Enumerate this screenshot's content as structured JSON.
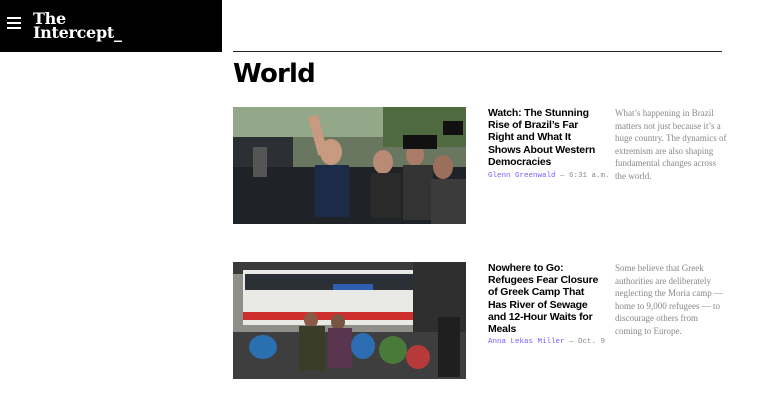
{
  "header": {
    "logo_line1": "The",
    "logo_line2": "Intercept_",
    "menu_icon": "hamburger-menu-icon"
  },
  "section": {
    "title": "World"
  },
  "articles": [
    {
      "headline": "Watch: The Stunning Rise of Brazil’s Far Right and What It Shows About Western Democracies",
      "author": "Glenn Greenwald",
      "separator": " — ",
      "date": "6:31 a.m.",
      "excerpt": "What’s happening in Brazil matters not just because it’s a huge country. The dynamics of extremism are also shaping fundamental changes across the world."
    },
    {
      "headline": "Nowhere to Go: Refugees Fear Closure of Greek Camp That Has River of Sewage and 12-Hour Waits for Meals",
      "author": "Anna Lekas Miller",
      "separator": " — ",
      "date": "Oct. 9",
      "excerpt": "Some believe that Greek authorities are deliberately neglecting the Moria camp — home to 9,000 refugees — to discourage others from coming to Europe."
    }
  ]
}
